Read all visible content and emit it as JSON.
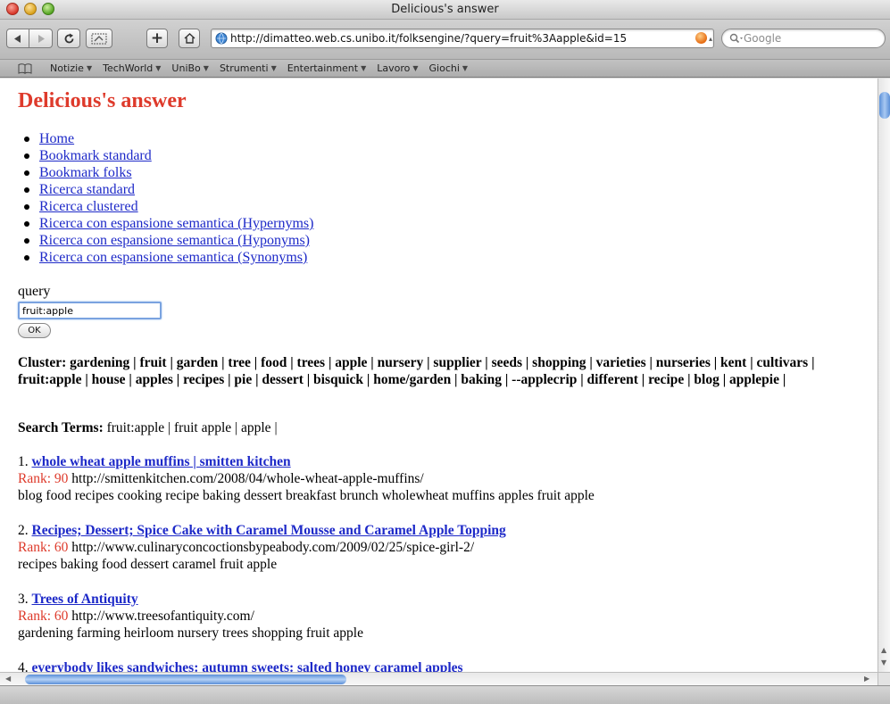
{
  "window": {
    "title": "Delicious's answer"
  },
  "toolbar": {
    "url": "http://dimatteo.web.cs.unibo.it/folksengine/?query=fruit%3Aapple&id=15",
    "search_placeholder": "Google",
    "add_label": "+"
  },
  "bookmarks": [
    "Notizie",
    "TechWorld",
    "UniBo",
    "Strumenti",
    "Entertainment",
    "Lavoro",
    "Giochi"
  ],
  "page": {
    "heading": "Delicious's answer",
    "nav": [
      "Home",
      "Bookmark standard",
      "Bookmark folks",
      "Ricerca standard",
      "Ricerca clustered",
      "Ricerca con espansione semantica (Hypernyms)",
      "Ricerca con espansione semantica (Hyponyms)",
      "Ricerca con espansione semantica (Synonyms)"
    ],
    "query_label": "query",
    "query_value": "fruit:apple",
    "ok_label": "OK",
    "cluster_text": "Cluster: gardening | fruit | garden | tree | food | trees | apple | nursery | supplier | seeds | shopping | varieties | nurseries | kent | cultivars | fruit:apple | house | apples | recipes | pie | dessert | bisquick | home/garden | baking | --applecrip | different | recipe | blog | applepie |",
    "search_terms_label": "Search Terms:",
    "search_terms_value": " fruit:apple | fruit apple | apple |",
    "results": [
      {
        "number": "1.",
        "title": "whole wheat apple muffins | smitten kitchen",
        "rank_label": "Rank: 90",
        "url": " http://smittenkitchen.com/2008/04/whole-wheat-apple-muffins/",
        "tags": "blog food recipes cooking recipe baking dessert breakfast brunch wholewheat muffins apples fruit apple"
      },
      {
        "number": "2.",
        "title": "Recipes; Dessert; Spice Cake with Caramel Mousse and Caramel Apple Topping",
        "rank_label": "Rank: 60",
        "url": " http://www.culinaryconcoctionsbypeabody.com/2009/02/25/spice-girl-2/",
        "tags": "recipes baking food dessert caramel fruit apple"
      },
      {
        "number": "3.",
        "title": "Trees of Antiquity",
        "rank_label": "Rank: 60",
        "url": " http://www.treesofantiquity.com/",
        "tags": "gardening farming heirloom nursery trees shopping fruit apple"
      },
      {
        "number": "4.",
        "title": "everybody likes sandwiches: autumn sweets: salted honey caramel apples"
      }
    ]
  },
  "colors": {
    "heading": "#de3a2b",
    "link": "#1d29c8",
    "rank": "#de3a2b"
  }
}
